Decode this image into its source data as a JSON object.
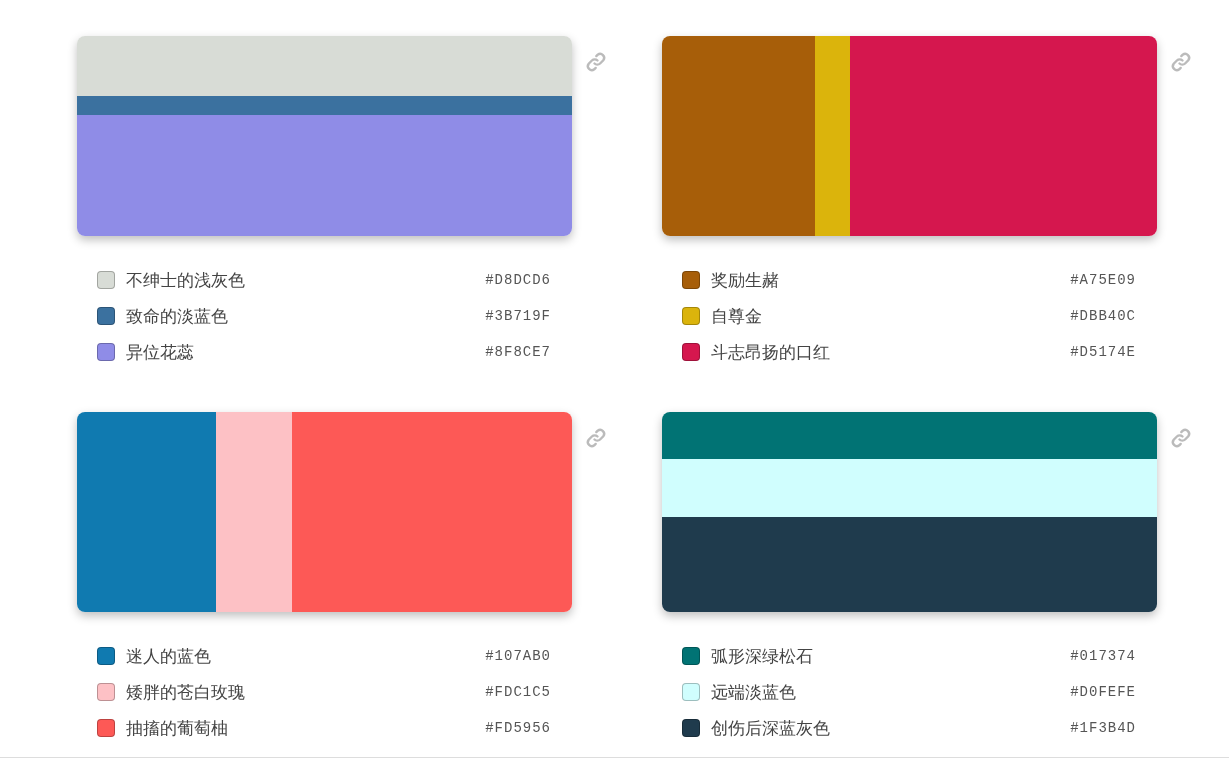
{
  "palettes": [
    {
      "kind": "rows",
      "colors": [
        {
          "name": "不绅士的浅灰色",
          "hex": "#D8DCD6",
          "color": "#d8dcd6"
        },
        {
          "name": "致命的淡蓝色",
          "hex": "#3B719F",
          "color": "#3b719f"
        },
        {
          "name": "异位花蕊",
          "hex": "#8F8CE7",
          "color": "#8f8ce7"
        }
      ]
    },
    {
      "kind": "columns",
      "colors": [
        {
          "name": "奖励生赭",
          "hex": "#A75E09",
          "color": "#a75e09"
        },
        {
          "name": "自尊金",
          "hex": "#DBB40C",
          "color": "#dbb40c"
        },
        {
          "name": "斗志昂扬的口红",
          "hex": "#D5174E",
          "color": "#d5174e"
        }
      ]
    },
    {
      "kind": "columns",
      "colors": [
        {
          "name": "迷人的蓝色",
          "hex": "#107AB0",
          "color": "#107ab0"
        },
        {
          "name": "矮胖的苍白玫瑰",
          "hex": "#FDC1C5",
          "color": "#fdc1c5"
        },
        {
          "name": "抽搐的葡萄柚",
          "hex": "#FD5956",
          "color": "#fd5956"
        }
      ]
    },
    {
      "kind": "rows",
      "colors": [
        {
          "name": "弧形深绿松石",
          "hex": "#017374",
          "color": "#017374"
        },
        {
          "name": "远端淡蓝色",
          "hex": "#D0FEFE",
          "color": "#d0fefe"
        },
        {
          "name": "创伤后深蓝灰色",
          "hex": "#1F3B4D",
          "color": "#1f3b4d"
        }
      ]
    }
  ]
}
